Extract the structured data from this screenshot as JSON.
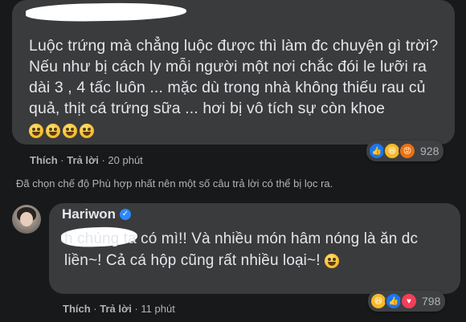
{
  "comment1": {
    "text": "Luộc trứng mà chẳng luộc được thì làm đc chuyện gì trời? Nếu như bị cách ly mỗi người một nơi chắc đói le lưỡi ra dài 3 , 4 tấc luôn ... mặc dù trong nhà không thiếu rau củ quả, thịt cá trứng sữa ... hơi bị vô tích sự còn khoe",
    "emojis": [
      "grimacing-emoji",
      "laughing-emoji",
      "laughing-emoji",
      "laughing-emoji"
    ],
    "like_label": "Thích",
    "reply_label": "Trả lời",
    "time": "20 phút",
    "reaction_count": "928",
    "reactions": [
      "like",
      "haha",
      "angry"
    ]
  },
  "filter_notice": "Đã chọn chế độ Phù hợp nhất nên một số câu trả lời có thể bị lọc ra.",
  "comment2": {
    "author": "Hariwon",
    "verified": true,
    "text": "h chúng ta có mì!! Và nhiều món hâm nóng là ăn dc liền~! Cả cá hộp cũng rất nhiều loại~!",
    "like_label": "Thích",
    "reply_label": "Trả lời",
    "time": "11 phút",
    "reaction_count": "798",
    "reactions": [
      "haha",
      "like",
      "love"
    ]
  },
  "colors": {
    "background": "#18191a",
    "bubble": "#3a3b3c",
    "text": "#e4e6eb",
    "secondary_text": "#b0b3b8",
    "like_blue": "#1877f2",
    "verified_blue": "#2d88ff"
  }
}
